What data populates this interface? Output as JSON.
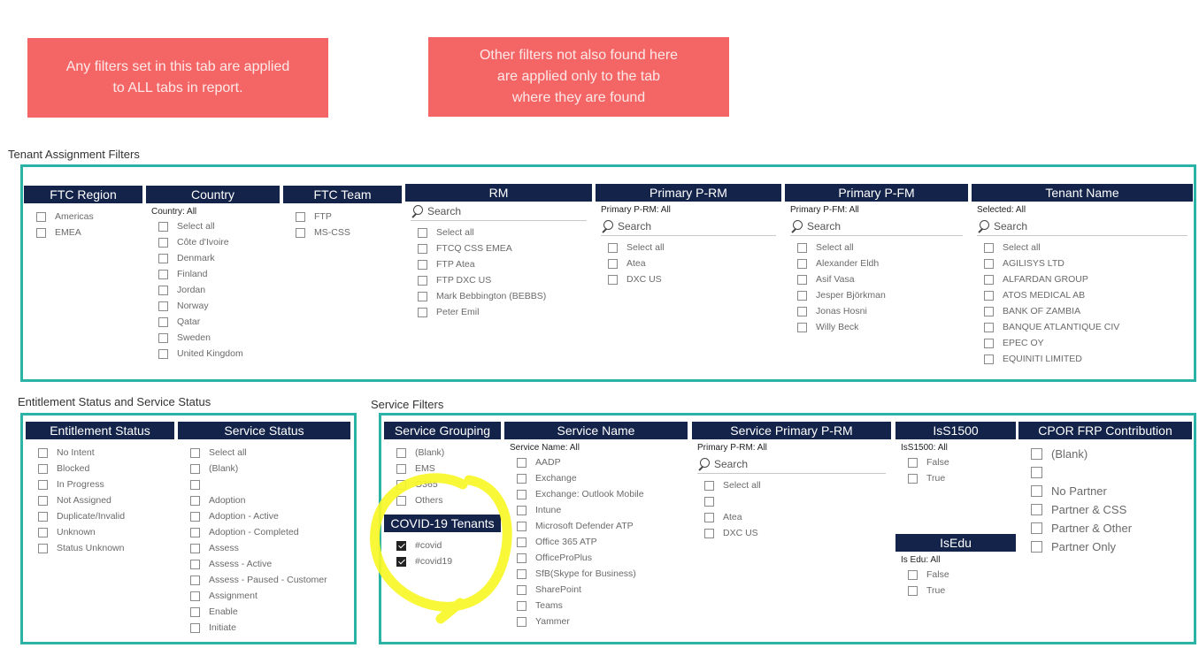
{
  "notes": {
    "left": "Any filters set in this tab are applied\nto ALL tabs in report.",
    "right": "Other filters not also found here\nare applied only to the tab\nwhere they are found"
  },
  "sections": {
    "tenant_assignment": "Tenant Assignment Filters",
    "entitlement": "Entitlement Status and Service Status",
    "service": "Service Filters"
  },
  "colors": {
    "note": "#f46666",
    "frame": "#2ab3a6",
    "header": "#13234a",
    "highlight": "#f7f727"
  },
  "slicers": {
    "ftc_region": {
      "title": "FTC Region",
      "items": [
        {
          "label": "Americas"
        },
        {
          "label": "EMEA"
        }
      ]
    },
    "country": {
      "title": "Country",
      "sub": "Country: All",
      "items": [
        {
          "label": "Select all"
        },
        {
          "label": "Côte d'Ivoire"
        },
        {
          "label": "Denmark"
        },
        {
          "label": "Finland"
        },
        {
          "label": "Jordan"
        },
        {
          "label": "Norway"
        },
        {
          "label": "Qatar"
        },
        {
          "label": "Sweden"
        },
        {
          "label": "United Kingdom"
        }
      ]
    },
    "ftc_team": {
      "title": "FTC Team",
      "items": [
        {
          "label": "FTP"
        },
        {
          "label": "MS-CSS"
        }
      ]
    },
    "rm": {
      "title": "RM",
      "search": "Search",
      "items": [
        {
          "label": "Select all"
        },
        {
          "label": "FTCQ CSS EMEA"
        },
        {
          "label": "FTP Atea"
        },
        {
          "label": "FTP DXC US"
        },
        {
          "label": "Mark Bebbington (BEBBS)"
        },
        {
          "label": "Peter Emil"
        }
      ]
    },
    "primary_prm": {
      "title": "Primary P-RM",
      "sub": "Primary P-RM: All",
      "search": "Search",
      "items": [
        {
          "label": "Select all"
        },
        {
          "label": "Atea"
        },
        {
          "label": "DXC US"
        }
      ]
    },
    "primary_pfm": {
      "title": "Primary P-FM",
      "sub": "Primary P-FM: All",
      "search": "Search",
      "items": [
        {
          "label": "Select all"
        },
        {
          "label": "Alexander Eldh"
        },
        {
          "label": "Asif Vasa"
        },
        {
          "label": "Jesper Björkman"
        },
        {
          "label": "Jonas Hosni"
        },
        {
          "label": "Willy Beck"
        }
      ]
    },
    "tenant_name": {
      "title": "Tenant Name",
      "sub": "Selected: All",
      "search": "Search",
      "items": [
        {
          "label": "Select all"
        },
        {
          "label": "AGILISYS LTD"
        },
        {
          "label": "ALFARDAN GROUP"
        },
        {
          "label": "ATOS MEDICAL AB"
        },
        {
          "label": "BANK OF ZAMBIA"
        },
        {
          "label": "BANQUE ATLANTIQUE CIV"
        },
        {
          "label": "EPEC OY"
        },
        {
          "label": "EQUINITI LIMITED"
        }
      ]
    },
    "entitlement_status": {
      "title": "Entitlement Status",
      "items": [
        {
          "label": "No Intent"
        },
        {
          "label": "Blocked"
        },
        {
          "label": "In Progress"
        },
        {
          "label": "Not Assigned"
        },
        {
          "label": "Duplicate/Invalid"
        },
        {
          "label": "Unknown"
        },
        {
          "label": "Status Unknown"
        }
      ]
    },
    "service_status": {
      "title": "Service Status",
      "items": [
        {
          "label": "Select all"
        },
        {
          "label": "(Blank)"
        },
        {
          "label": ""
        },
        {
          "label": "Adoption"
        },
        {
          "label": "Adoption - Active"
        },
        {
          "label": "Adoption - Completed"
        },
        {
          "label": "Assess"
        },
        {
          "label": "Assess - Active"
        },
        {
          "label": "Assess - Paused - Customer"
        },
        {
          "label": "Assignment"
        },
        {
          "label": "Enable"
        },
        {
          "label": "Initiate"
        }
      ]
    },
    "service_grouping": {
      "title": "Service Grouping",
      "items": [
        {
          "label": "(Blank)"
        },
        {
          "label": "EMS"
        },
        {
          "label": "O365"
        },
        {
          "label": "Others"
        }
      ]
    },
    "covid": {
      "title": "COVID-19 Tenants",
      "items": [
        {
          "label": "#covid",
          "checked": true
        },
        {
          "label": "#covid19",
          "checked": true
        }
      ]
    },
    "service_name": {
      "title": "Service Name",
      "sub": "Service Name: All",
      "items": [
        {
          "label": "AADP"
        },
        {
          "label": "Exchange"
        },
        {
          "label": "Exchange: Outlook Mobile"
        },
        {
          "label": "Intune"
        },
        {
          "label": "Microsoft Defender ATP"
        },
        {
          "label": "Office 365 ATP"
        },
        {
          "label": "OfficeProPlus"
        },
        {
          "label": "SfB(Skype for Business)"
        },
        {
          "label": "SharePoint"
        },
        {
          "label": "Teams"
        },
        {
          "label": "Yammer"
        }
      ]
    },
    "service_prm": {
      "title": "Service Primary P-RM",
      "sub": "Primary P-RM: All",
      "search": "Search",
      "items": [
        {
          "label": "Select all"
        },
        {
          "label": ""
        },
        {
          "label": "Atea"
        },
        {
          "label": "DXC US"
        }
      ]
    },
    "iss1500": {
      "title": "IsS1500",
      "sub": "IsS1500: All",
      "items": [
        {
          "label": "False"
        },
        {
          "label": "True"
        }
      ]
    },
    "isedu": {
      "title": "IsEdu",
      "sub": "Is Edu: All",
      "items": [
        {
          "label": "False"
        },
        {
          "label": "True"
        }
      ]
    },
    "cpor": {
      "title": "CPOR FRP Contribution",
      "items": [
        {
          "label": "(Blank)"
        },
        {
          "label": ""
        },
        {
          "label": "No Partner"
        },
        {
          "label": "Partner & CSS"
        },
        {
          "label": "Partner & Other"
        },
        {
          "label": "Partner Only"
        }
      ]
    }
  }
}
